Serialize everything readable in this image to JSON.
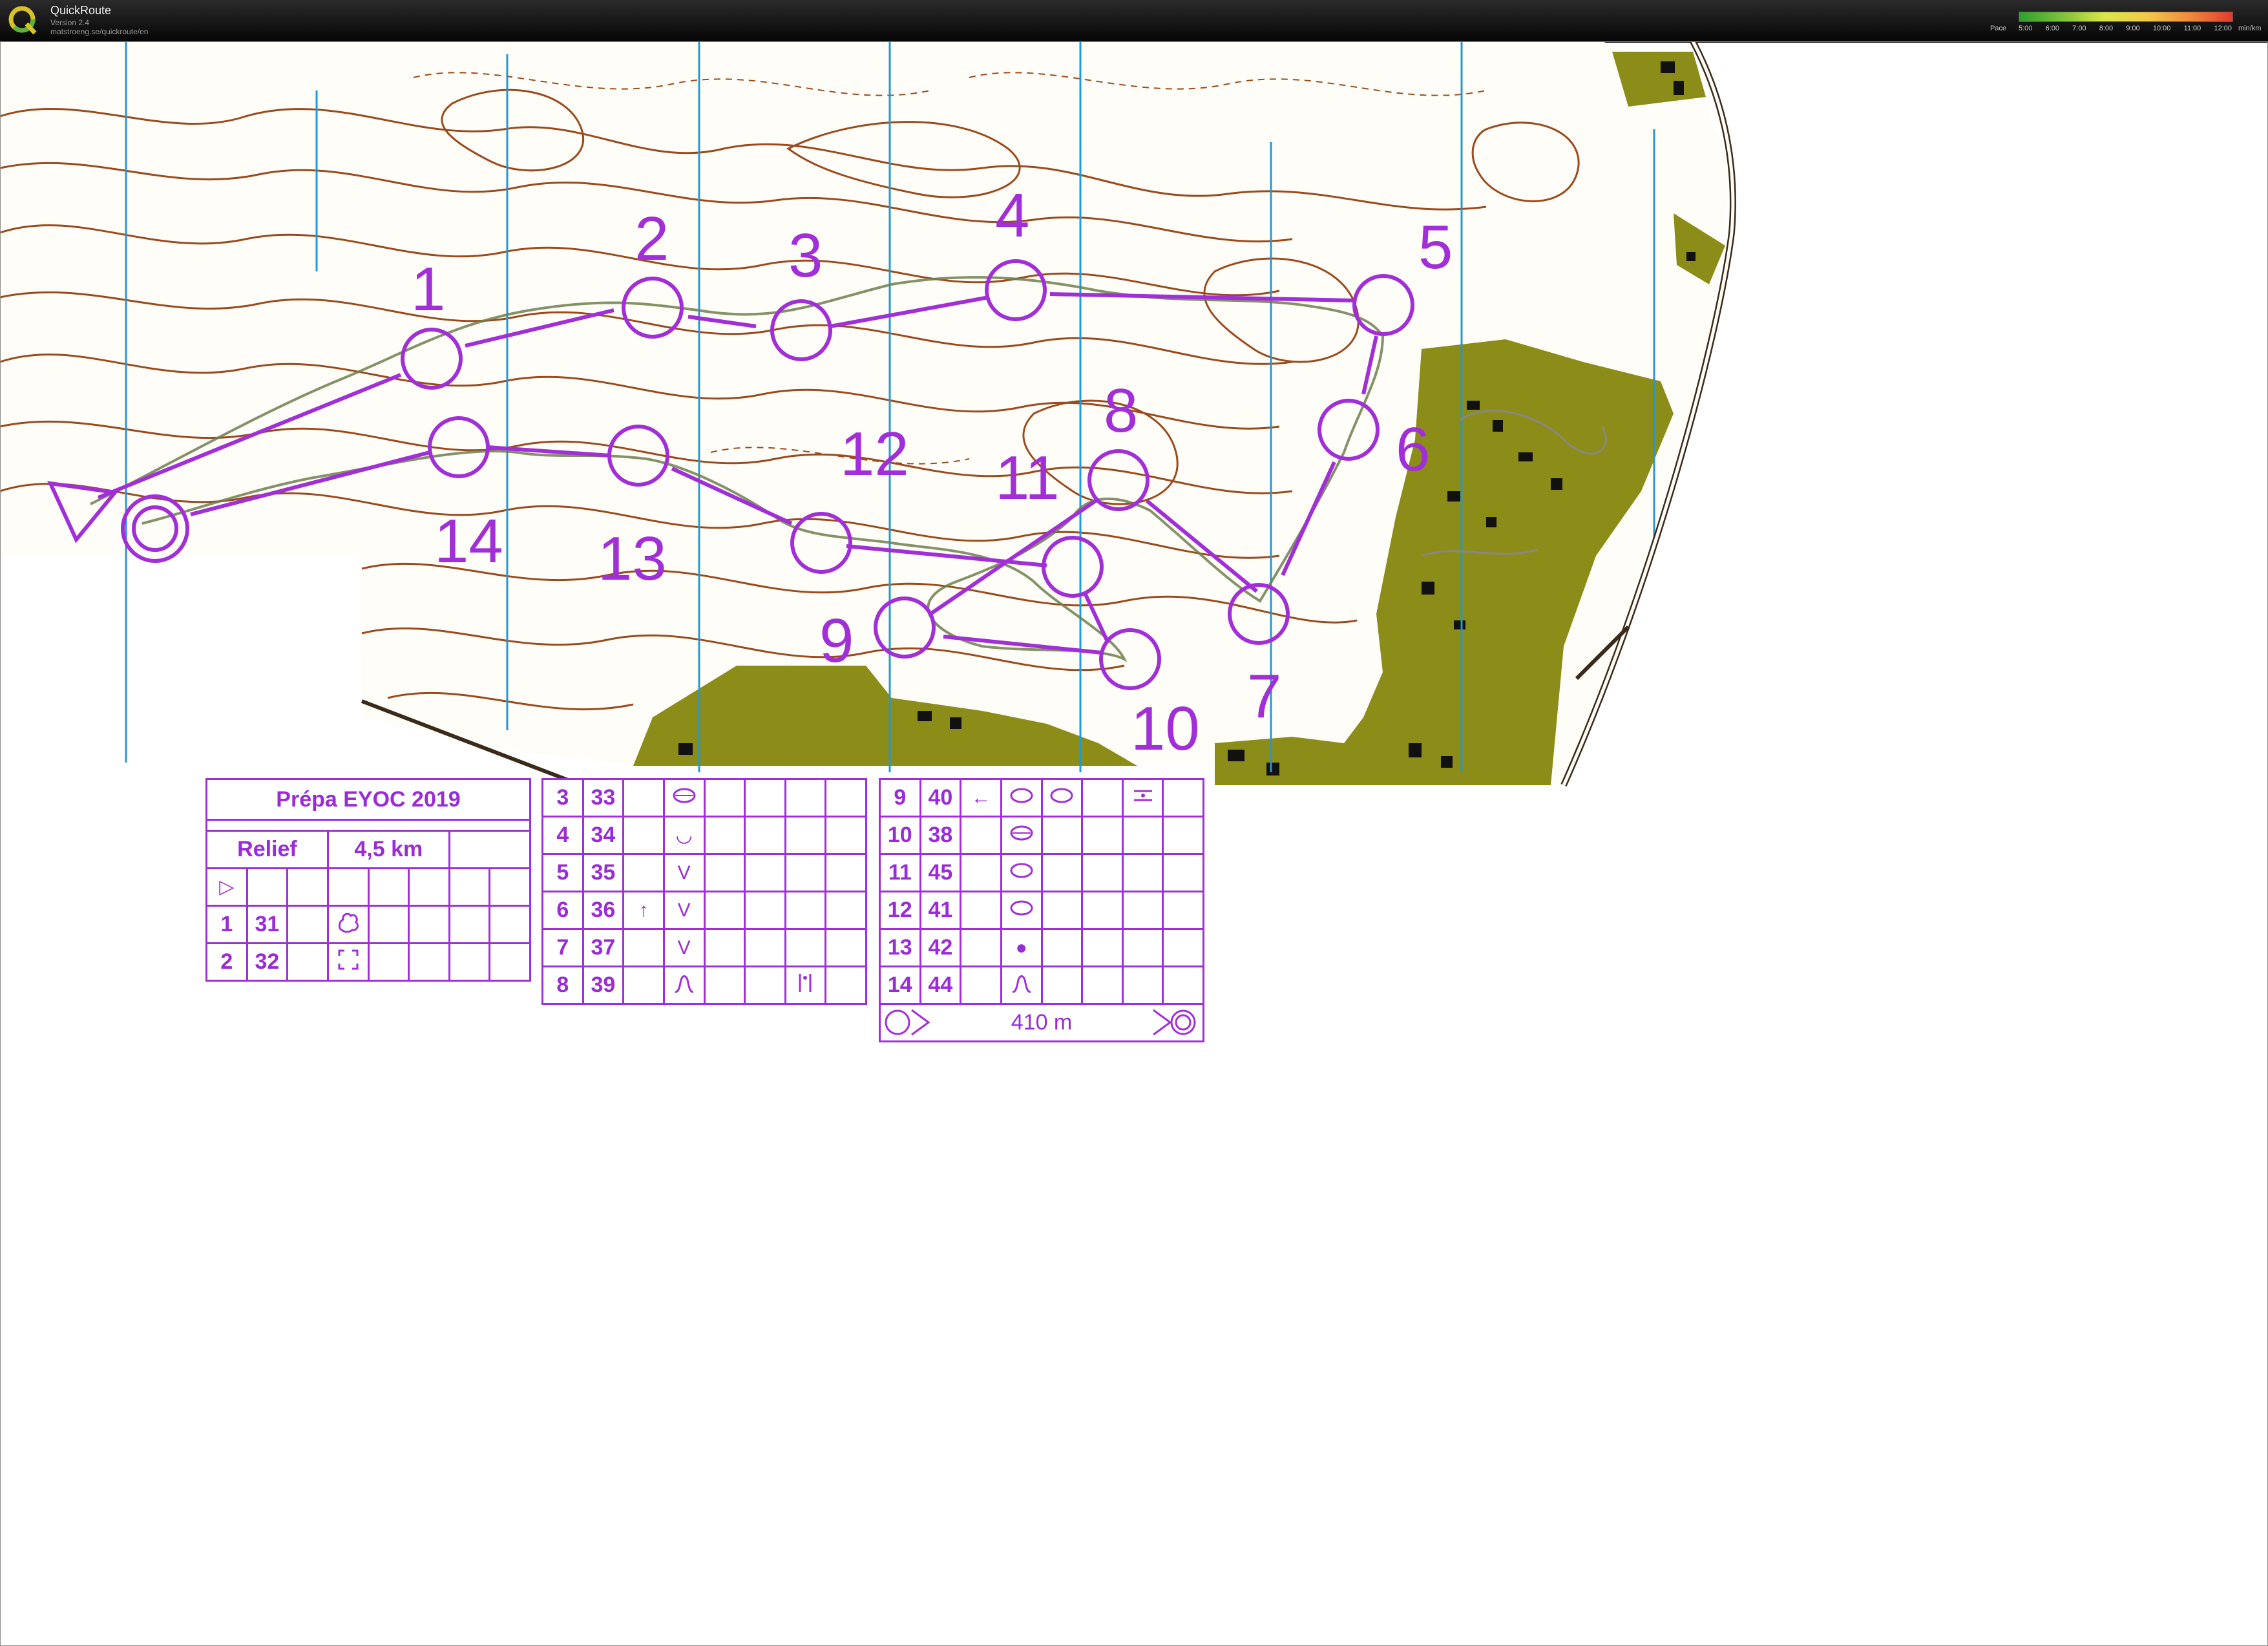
{
  "app": {
    "title": "QuickRoute",
    "version": "Version 2.4",
    "url": "matstroeng.se/quickroute/en"
  },
  "pace_legend": {
    "label": "Pace",
    "unit": "min/km",
    "ticks": [
      "5:00",
      "6:00",
      "7:00",
      "8:00",
      "9:00",
      "10:00",
      "11:00",
      "12:00"
    ],
    "colors": [
      "#2f9e2f",
      "#7cc23a",
      "#d9e64a",
      "#f2c94a",
      "#f08a3c",
      "#e23b2f"
    ]
  },
  "map": {
    "control_numbers": [
      "1",
      "2",
      "3",
      "4",
      "5",
      "6",
      "7",
      "8",
      "9",
      "10",
      "11",
      "12",
      "13",
      "14"
    ],
    "colors": {
      "course": "#a12fd8",
      "contour": "#9a4a1c",
      "settlement": "#8c8c18",
      "magnetic_north": "#1f9ad6",
      "route": "#6f7f4f"
    }
  },
  "control_description": {
    "title": "Prépa EYOC 2019",
    "class": "Relief",
    "length": "4,5 km",
    "start_symbol": "▷",
    "rows": [
      {
        "n": "1",
        "code": "31",
        "c": "",
        "d": "",
        "e": "",
        "f": "",
        "g": "",
        "h": ""
      },
      {
        "n": "2",
        "code": "32",
        "c": "",
        "d": "",
        "e": "",
        "f": "",
        "g": "",
        "h": ""
      },
      {
        "n": "3",
        "code": "33",
        "c": "",
        "d": "",
        "e": "",
        "f": "",
        "g": "",
        "h": ""
      },
      {
        "n": "4",
        "code": "34",
        "c": "",
        "d": "◡",
        "e": "",
        "f": "",
        "g": "",
        "h": ""
      },
      {
        "n": "5",
        "code": "35",
        "c": "",
        "d": "V",
        "e": "",
        "f": "",
        "g": "",
        "h": ""
      },
      {
        "n": "6",
        "code": "36",
        "c": "↑",
        "d": "V",
        "e": "",
        "f": "",
        "g": "",
        "h": ""
      },
      {
        "n": "7",
        "code": "37",
        "c": "",
        "d": "V",
        "e": "",
        "f": "",
        "g": "",
        "h": ""
      },
      {
        "n": "8",
        "code": "39",
        "c": "",
        "d": "",
        "e": "",
        "f": "",
        "g": "",
        "h": ""
      },
      {
        "n": "9",
        "code": "40",
        "c": "←",
        "d": "",
        "e": "",
        "f": "",
        "g": "",
        "h": ""
      },
      {
        "n": "10",
        "code": "38",
        "c": "",
        "d": "",
        "e": "",
        "f": "",
        "g": "",
        "h": ""
      },
      {
        "n": "11",
        "code": "45",
        "c": "",
        "d": "",
        "e": "",
        "f": "",
        "g": "",
        "h": ""
      },
      {
        "n": "12",
        "code": "41",
        "c": "",
        "d": "",
        "e": "",
        "f": "",
        "g": "",
        "h": ""
      },
      {
        "n": "13",
        "code": "42",
        "c": "",
        "d": "●",
        "e": "",
        "f": "",
        "g": "",
        "h": ""
      },
      {
        "n": "14",
        "code": "44",
        "c": "",
        "d": "",
        "e": "",
        "f": "",
        "g": "",
        "h": ""
      }
    ],
    "finish_distance": "410 m"
  }
}
